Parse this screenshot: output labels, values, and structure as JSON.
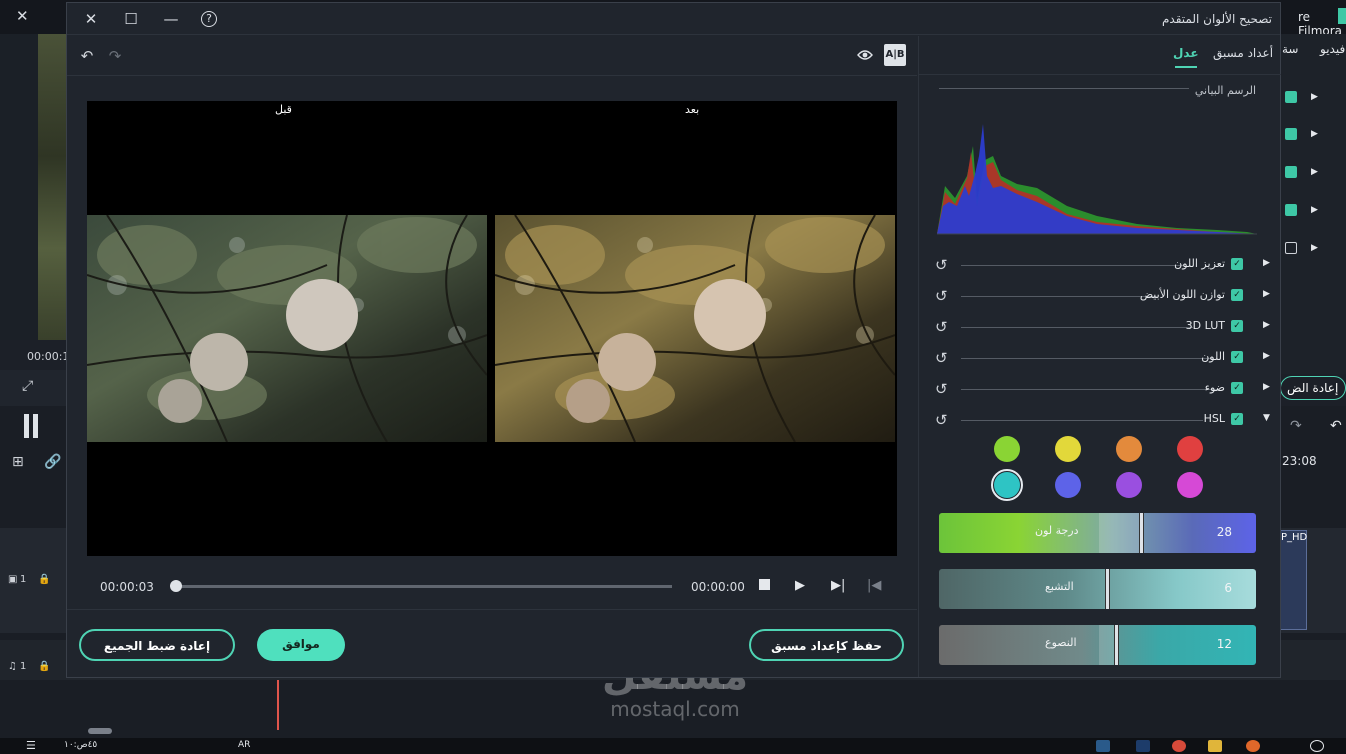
{
  "background_app": {
    "title_fragment": "re Filmora",
    "timecode": "00:00:1",
    "tabs": [
      "فيديو",
      "سة"
    ],
    "reset_button_fragment": "إعادة الض",
    "clock": "23:08",
    "clip_label": "P_HD",
    "track1_label": "1",
    "track2_label": "1",
    "taskbar_lang": "AR",
    "taskbar_time": "۱۰:٤٥ص"
  },
  "watermark": {
    "arabic": "مستقل",
    "latin": "mostaql.com"
  },
  "modal": {
    "title": "تصحيح الألوان المتقدم",
    "window_controls": {
      "close_icon": "close-icon",
      "maximize_icon": "maximize-icon",
      "minimize_icon": "minimize-icon",
      "help_icon": "help-icon"
    },
    "preview": {
      "before_label": "قبل",
      "after_label": "بعد",
      "current_time": "00:00:03",
      "end_time": "00:00:00",
      "progress_fraction": 0.0
    },
    "footer": {
      "reset_all": "إعادة ضبط الجميع",
      "ok": "موافق",
      "save_preset": "حفظ كإعداد مسبق"
    },
    "right_panel": {
      "tabs": {
        "custom": "عدل",
        "preset": "أعداد مسبق"
      },
      "histogram_label": "الرسم البياني",
      "sections": [
        {
          "label": "تعزيز اللون",
          "checked": true,
          "expanded": false
        },
        {
          "label": "توازن اللون الأبيض",
          "checked": true,
          "expanded": false
        },
        {
          "label": "3D LUT",
          "checked": true,
          "expanded": false
        },
        {
          "label": "اللون",
          "checked": true,
          "expanded": false
        },
        {
          "label": "ضوء",
          "checked": true,
          "expanded": false
        },
        {
          "label": "HSL",
          "checked": true,
          "expanded": true
        }
      ],
      "hsl_swatches": [
        {
          "name": "red",
          "color": "#e04040"
        },
        {
          "name": "orange",
          "color": "#e38a3c"
        },
        {
          "name": "yellow",
          "color": "#e2d83a"
        },
        {
          "name": "green",
          "color": "#8ad434"
        },
        {
          "name": "magenta",
          "color": "#d649d6"
        },
        {
          "name": "purple",
          "color": "#9a4fe0"
        },
        {
          "name": "blue",
          "color": "#5d63e8"
        },
        {
          "name": "aqua",
          "color": "#2ec4c4",
          "selected": true
        }
      ],
      "sliders": [
        {
          "label": "درجة لون",
          "value": "28"
        },
        {
          "label": "التشبع",
          "value": "6"
        },
        {
          "label": "النصوع",
          "value": "12"
        }
      ]
    }
  }
}
